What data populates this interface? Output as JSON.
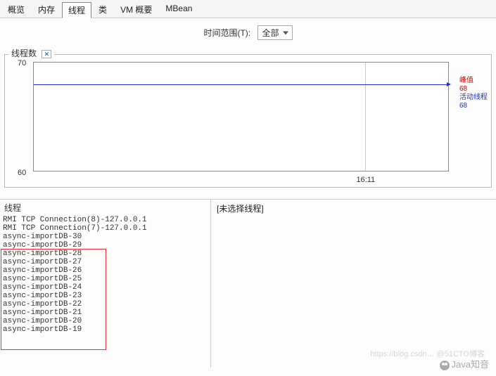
{
  "tabs": {
    "items": [
      "概览",
      "内存",
      "线程",
      "类",
      "VM 概要",
      "MBean"
    ],
    "active_index": 2
  },
  "time_range": {
    "label": "时间范围(T):",
    "selected": "全部"
  },
  "chart": {
    "title": "线程数",
    "toggle_glyph": "✕"
  },
  "chart_data": {
    "type": "line",
    "x": [
      "16:11"
    ],
    "series": [
      {
        "name": "活动线程",
        "values": [
          68
        ],
        "color": "#2030d0"
      }
    ],
    "yticks": [
      60,
      70
    ],
    "ylim": [
      60,
      70
    ],
    "xlabel": "",
    "ylabel": "",
    "peak_label": "峰值",
    "peak_value": 68,
    "live_label": "活动线程",
    "live_value": 68,
    "grid_x_positions_pct": [
      80
    ]
  },
  "threads_panel": {
    "title": "线程",
    "items": [
      "RMI TCP Connection(8)-127.0.0.1",
      "RMI TCP Connection(7)-127.0.0.1",
      "async-importDB-30",
      "async-importDB-29",
      "async-importDB-28",
      "async-importDB-27",
      "async-importDB-26",
      "async-importDB-25",
      "async-importDB-24",
      "async-importDB-23",
      "async-importDB-22",
      "async-importDB-21",
      "async-importDB-20",
      "async-importDB-19"
    ],
    "highlight_start": 2,
    "highlight_end": 13
  },
  "detail": {
    "placeholder": "[未选择线程]"
  },
  "watermark": {
    "main": "Java知音",
    "sub": "https://blog.csdn… @51CTO博客"
  }
}
